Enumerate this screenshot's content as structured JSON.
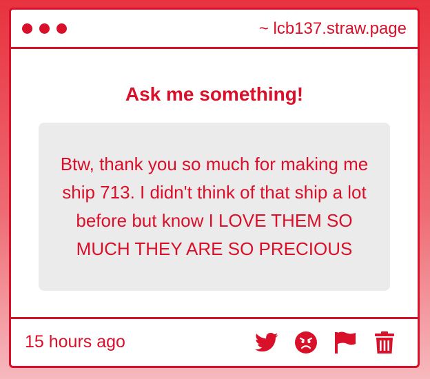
{
  "window": {
    "url": "~ lcb137.straw.page"
  },
  "main": {
    "heading": "Ask me something!",
    "question": "Btw, thank you so much for making me ship 713. I didn't think of that ship a lot before but know I LOVE THEM SO MUCH THEY ARE SO PRECIOUS"
  },
  "footer": {
    "timestamp": "15 hours ago",
    "actions": [
      "twitter-icon",
      "angry-face-icon",
      "flag-icon",
      "trash-icon"
    ]
  },
  "colors": {
    "accent": "#d9102a",
    "box_background": "#ecebec",
    "card_background": "#ffffff"
  }
}
